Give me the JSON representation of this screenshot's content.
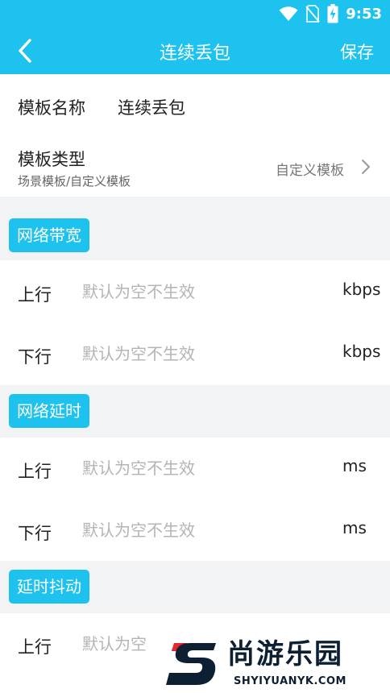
{
  "status_bar": {
    "time": "9:53",
    "icons": [
      "wifi-icon",
      "no-sim-icon",
      "battery-charging-icon"
    ]
  },
  "navbar": {
    "back_icon": "chevron-left-icon",
    "title": "连续丢包",
    "save_label": "保存"
  },
  "template": {
    "name_label": "模板名称",
    "name_value": "连续丢包",
    "type_label": "模板类型",
    "type_hint": "场景模板/自定义模板",
    "type_value": "自定义模板",
    "type_icon": "chevron-right-icon"
  },
  "sections": [
    {
      "title": "网络带宽",
      "rows": [
        {
          "label": "上行",
          "placeholder": "默认为空不生效",
          "value": "",
          "unit": "kbps"
        },
        {
          "label": "下行",
          "placeholder": "默认为空不生效",
          "value": "",
          "unit": "kbps"
        }
      ]
    },
    {
      "title": "网络延时",
      "rows": [
        {
          "label": "上行",
          "placeholder": "默认为空不生效",
          "value": "",
          "unit": "ms"
        },
        {
          "label": "下行",
          "placeholder": "默认为空不生效",
          "value": "",
          "unit": "ms"
        }
      ]
    },
    {
      "title": "延时抖动",
      "rows": [
        {
          "label": "上行",
          "placeholder": "默认为空",
          "value": ""
        }
      ]
    }
  ],
  "watermark": {
    "brand": "尚游乐园",
    "domain": "SHYIYUANYK.COM",
    "colors": {
      "primary": "#0d1f33",
      "accent": "#e8262d"
    }
  },
  "colors": {
    "accent": "#1dc3ee",
    "background": "#f2f3f5",
    "card": "#ffffff",
    "placeholder": "#b4b4b4"
  }
}
